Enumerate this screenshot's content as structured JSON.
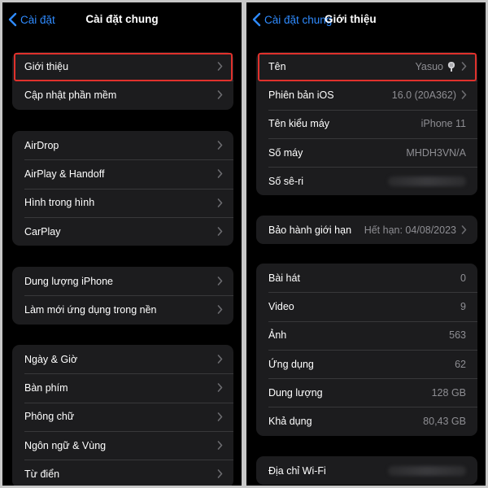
{
  "colors": {
    "accent": "#2f8bff",
    "highlight": "#e0312c",
    "row_bg": "#1c1c1e",
    "secondary_text": "#8e8e93"
  },
  "left_screen": {
    "back_label": "Cài đặt",
    "title": "Cài đặt chung",
    "groups": [
      {
        "items": [
          {
            "label": "Giới thiệu"
          },
          {
            "label": "Cập nhật phần mềm"
          }
        ]
      },
      {
        "items": [
          {
            "label": "AirDrop"
          },
          {
            "label": "AirPlay & Handoff"
          },
          {
            "label": "Hình trong hình"
          },
          {
            "label": "CarPlay"
          }
        ]
      },
      {
        "items": [
          {
            "label": "Dung lượng iPhone"
          },
          {
            "label": "Làm mới ứng dụng trong nền"
          }
        ]
      },
      {
        "items": [
          {
            "label": "Ngày & Giờ"
          },
          {
            "label": "Bàn phím"
          },
          {
            "label": "Phông chữ"
          },
          {
            "label": "Ngôn ngữ & Vùng"
          },
          {
            "label": "Từ điển"
          }
        ]
      }
    ]
  },
  "right_screen": {
    "back_label": "Cài đặt chung",
    "title": "Giới thiệu",
    "groups": [
      {
        "items": [
          {
            "label": "Tên",
            "value": "Yasuo"
          },
          {
            "label": "Phiên bản iOS",
            "value": "16.0 (20A362)"
          },
          {
            "label": "Tên kiểu máy",
            "value": "iPhone 11"
          },
          {
            "label": "Số máy",
            "value": "MHDH3VN/A"
          },
          {
            "label": "Số sê-ri",
            "value": ""
          }
        ]
      },
      {
        "items": [
          {
            "label": "Bảo hành giới hạn",
            "value": "Hết hạn: 04/08/2023"
          }
        ]
      },
      {
        "items": [
          {
            "label": "Bài hát",
            "value": "0"
          },
          {
            "label": "Video",
            "value": "9"
          },
          {
            "label": "Ảnh",
            "value": "563"
          },
          {
            "label": "Ứng dụng",
            "value": "62"
          },
          {
            "label": "Dung lượng",
            "value": "128 GB"
          },
          {
            "label": "Khả dụng",
            "value": "80,43 GB"
          }
        ]
      },
      {
        "items": [
          {
            "label": "Địa chỉ Wi-Fi",
            "value": ""
          }
        ]
      }
    ]
  }
}
